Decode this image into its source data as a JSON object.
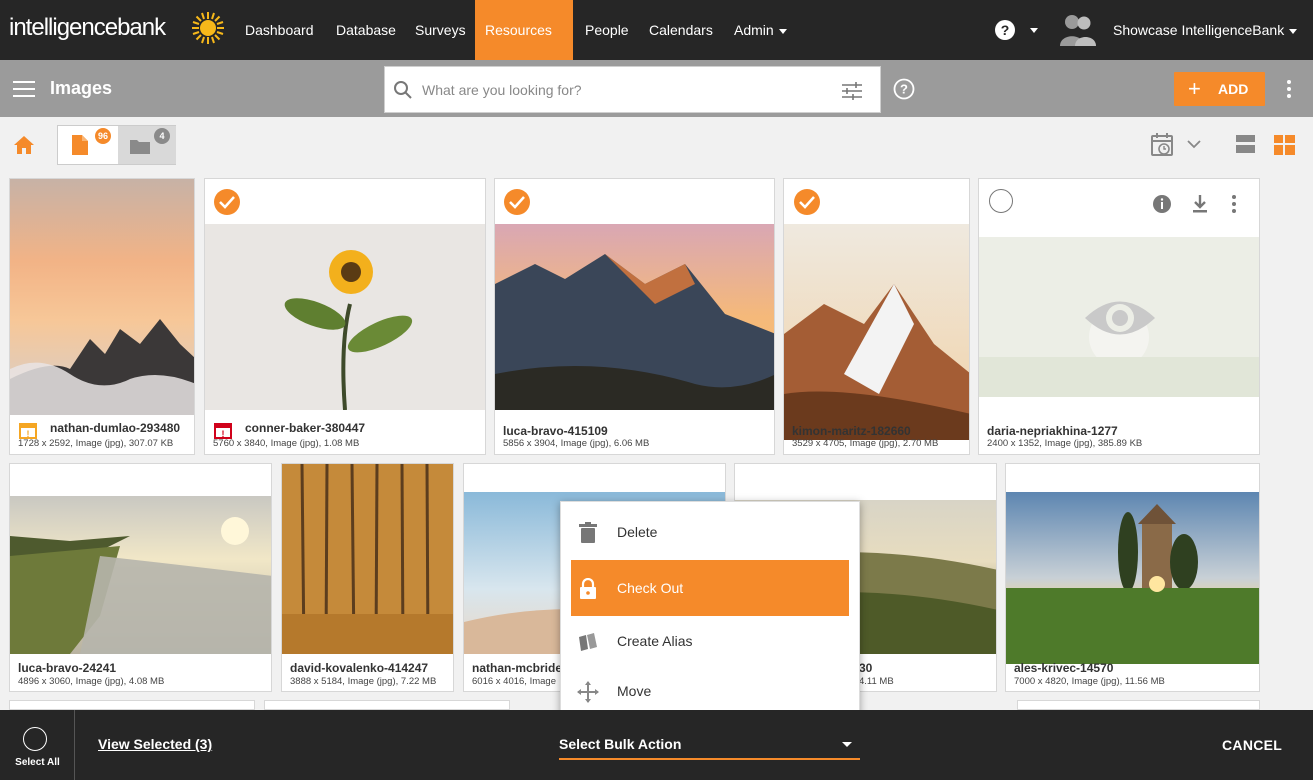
{
  "brand": {
    "logo_text": "intelligencebank",
    "accent": "#f58a2a",
    "dark": "#262626"
  },
  "nav": {
    "items": [
      {
        "label": "Dashboard"
      },
      {
        "label": "Database"
      },
      {
        "label": "Surveys"
      },
      {
        "label": "Resources",
        "active": true,
        "has_caret": true
      },
      {
        "label": "People"
      },
      {
        "label": "Calendars"
      },
      {
        "label": "Admin",
        "has_caret": true
      }
    ],
    "help_label": "?",
    "user_name": "Showcase IntelligenceBank"
  },
  "toolbar": {
    "title": "Images",
    "search_placeholder": "What are you looking for?",
    "add_label": "ADD",
    "add_icon": "+"
  },
  "filterbar": {
    "file_count": "96",
    "folder_count": "4"
  },
  "cards": [
    {
      "title": "nathan-dumlao-293480",
      "meta": "1728 x 2592, Image (jpg), 307.07 KB",
      "selected": false,
      "badge": "calendar-warning-orange-icon"
    },
    {
      "title": "conner-baker-380447",
      "meta": "5760 x 3840, Image (jpg), 1.08 MB",
      "selected": true,
      "badge": "calendar-warning-red-icon"
    },
    {
      "title": "luca-bravo-415109",
      "meta": "5856 x 3904, Image (jpg), 6.06 MB",
      "selected": true
    },
    {
      "title": "kimon-maritz-182660",
      "meta": "3529 x 4705, Image (jpg), 2.70 MB",
      "selected": true
    },
    {
      "title": "daria-nepriakhina-1277",
      "meta": "2400 x 1352, Image (jpg), 385.89 KB",
      "selected": false,
      "hover": true
    },
    {
      "title": "luca-bravo-24241",
      "meta": "4896 x 3060, Image (jpg), 4.08 MB"
    },
    {
      "title": "david-kovalenko-414247",
      "meta": "3888 x 5184, Image (jpg), 7.22 MB"
    },
    {
      "title": "nathan-mcbride",
      "meta": "6016 x 4016, Image"
    },
    {
      "title": "30",
      "meta": "4.11 MB"
    },
    {
      "title": "ales-krivec-14570",
      "meta": "7000 x 4820, Image (jpg), 11.56 MB"
    }
  ],
  "context_menu": {
    "items": [
      {
        "label": "Delete",
        "icon": "trash-icon"
      },
      {
        "label": "Check Out",
        "icon": "lock-icon",
        "active": true
      },
      {
        "label": "Create Alias",
        "icon": "alias-icon"
      },
      {
        "label": "Move",
        "icon": "move-icon"
      }
    ]
  },
  "bottombar": {
    "select_all": "Select All",
    "view_selected": "View Selected (3)",
    "bulk_action": "Select Bulk Action",
    "cancel": "CANCEL"
  }
}
